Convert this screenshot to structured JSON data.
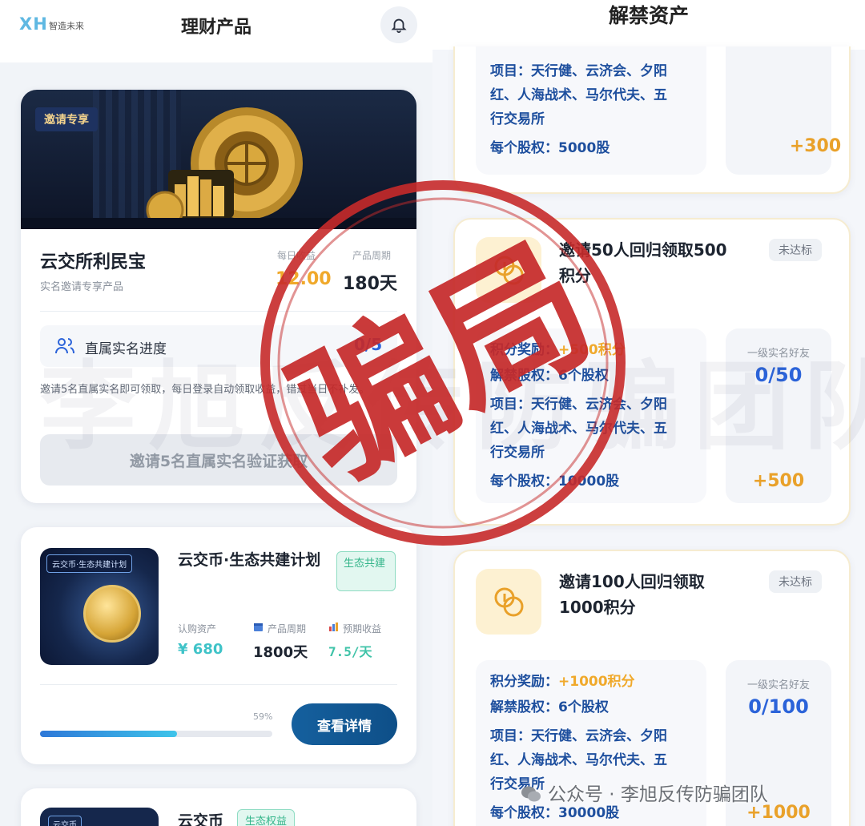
{
  "left": {
    "logo": "XH",
    "logo_sub": "智造未来",
    "title": "理财产品",
    "card1": {
      "tag": "邀请专享",
      "name": "云交所利民宝",
      "subtitle": "实名邀请专享产品",
      "daily_label": "每日收益",
      "daily_value": "12.00",
      "period_label": "产品周期",
      "period_value": "180天",
      "progress_label": "直属实名进度",
      "progress_value": "0/5",
      "note": "邀请5名直属实名即可领取，每日登录自动领取收益，错过当日不补发。",
      "button": "邀请5名直属实名验证获取"
    },
    "card2": {
      "thumb_tag": "云交币·生态共建计划",
      "name": "云交币·生态共建计划",
      "tag": "生态共建",
      "buy_label": "认购资产",
      "buy_value": "¥ 680",
      "period_label": "产品周期",
      "period_value": "1800天",
      "yield_label": "预期收益",
      "yield_value": "7.5/天",
      "percent": "59%",
      "progress": 0.59,
      "button": "查看详情"
    },
    "card3": {
      "thumb_tag": "云交币",
      "name": "云交币",
      "tag": "生态权益"
    }
  },
  "right": {
    "title": "解禁资产",
    "card0": {
      "project_1": "项目：天行健、云济会、夕阳",
      "project_2": "红、人海战术、马尔代夫、五",
      "project_3": "行交易所",
      "equity_label": "每个股权：",
      "equity_value": "5000股",
      "plus": "+300"
    },
    "card1": {
      "title_1": "邀请50人回归领取500",
      "title_2": "积分",
      "status": "未达标",
      "reward_label": "积分奖励：",
      "reward_value": "+500积分",
      "unlock_label": "解禁股权：",
      "unlock_value": "6个股权",
      "project_1": "项目：天行健、云济会、夕阳",
      "project_2": "红、人海战术、马尔代夫、五",
      "project_3": "行交易所",
      "equity_label": "每个股权：",
      "equity_value": "10000股",
      "friend_label": "一级实名好友",
      "friend_value": "0/50",
      "plus": "+500"
    },
    "card2": {
      "title_1": "邀请100人回归领取",
      "title_2": "1000积分",
      "status": "未达标",
      "reward_label": "积分奖励：",
      "reward_value": "+1000积分",
      "unlock_label": "解禁股权：",
      "unlock_value": "6个股权",
      "project_1": "项目：天行健、云济会、夕阳",
      "project_2": "红、人海战术、马尔代夫、五",
      "project_3": "行交易所",
      "equity_label": "每个股权：",
      "equity_value": "30000股",
      "friend_label": "一级实名好友",
      "friend_value": "0/100",
      "plus": "+1000"
    }
  },
  "overlay": {
    "stamp_text": "骗局",
    "watermark": "李旭反传防骗团队",
    "footer": "公众号 · 李旭反传防骗团队",
    "stamp_color": "#c62a2a"
  }
}
